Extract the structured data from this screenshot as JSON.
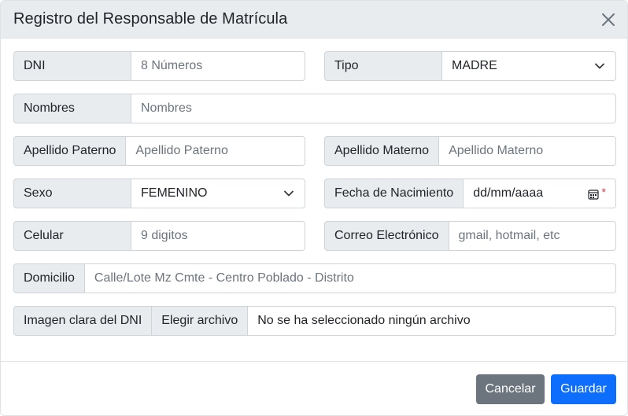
{
  "modal": {
    "title": "Registro del Responsable de Matrícula"
  },
  "fields": {
    "dni": {
      "label": "DNI",
      "placeholder": "8 Números"
    },
    "tipo": {
      "label": "Tipo",
      "value": "MADRE"
    },
    "nombres": {
      "label": "Nombres",
      "placeholder": "Nombres"
    },
    "apellido_paterno": {
      "label": "Apellido Paterno",
      "placeholder": "Apellido Paterno"
    },
    "apellido_materno": {
      "label": "Apellido Materno",
      "placeholder": "Apellido Materno"
    },
    "sexo": {
      "label": "Sexo",
      "value": "FEMENINO"
    },
    "fecha_nacimiento": {
      "label": "Fecha de Nacimiento",
      "value": "dd/mm/aaaa",
      "required_mark": "*"
    },
    "celular": {
      "label": "Celular",
      "placeholder": "9 digitos"
    },
    "correo": {
      "label": "Correo Electrónico",
      "placeholder": "gmail, hotmail, etc"
    },
    "domicilio": {
      "label": "Domicilio",
      "placeholder": "Calle/Lote Mz Cmte - Centro Poblado - Distrito"
    },
    "imagen_dni": {
      "label": "Imagen clara del DNI",
      "button": "Elegir archivo",
      "status": "No se ha seleccionado ningún archivo"
    }
  },
  "footer": {
    "cancel_label": "Cancelar",
    "save_label": "Guardar"
  },
  "icons": {
    "close": "close-icon",
    "chevron": "chevron-down-icon",
    "calendar": "calendar-icon"
  },
  "colors": {
    "header_bg": "#e9ecef",
    "addon_bg": "#e9ecef",
    "cancel_bg": "#6c757d",
    "save_bg": "#0d6efd",
    "required": "#dc3545"
  }
}
